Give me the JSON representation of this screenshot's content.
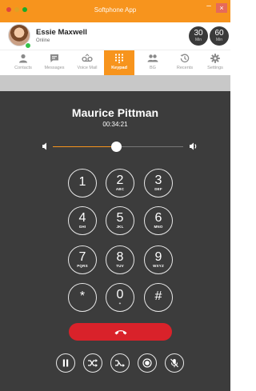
{
  "window": {
    "title": "Softphone App"
  },
  "user": {
    "name": "Essie Maxwell",
    "status": "Online"
  },
  "counters": [
    {
      "value": "30",
      "unit": "Min"
    },
    {
      "value": "60",
      "unit": "Min"
    }
  ],
  "tabs": [
    {
      "label": "Contacts",
      "icon": "person-icon"
    },
    {
      "label": "Messages",
      "icon": "message-icon"
    },
    {
      "label": "Voice Mail",
      "icon": "voicemail-icon"
    },
    {
      "label": "Keypad",
      "icon": "keypad-icon",
      "active": true
    },
    {
      "label": "BG",
      "icon": "group-icon"
    },
    {
      "label": "Recents",
      "icon": "history-icon"
    },
    {
      "label": "Settings",
      "icon": "gear-icon"
    }
  ],
  "call": {
    "name": "Maurice Pittman",
    "duration": "00:34:21",
    "volume": 0.49
  },
  "keys": [
    {
      "digit": "1",
      "letters": ""
    },
    {
      "digit": "2",
      "letters": "ABC"
    },
    {
      "digit": "3",
      "letters": "DEF"
    },
    {
      "digit": "4",
      "letters": "GHI"
    },
    {
      "digit": "5",
      "letters": "JKL"
    },
    {
      "digit": "6",
      "letters": "MNO"
    },
    {
      "digit": "7",
      "letters": "PQRS"
    },
    {
      "digit": "8",
      "letters": "TUV"
    },
    {
      "digit": "9",
      "letters": "WXYZ"
    },
    {
      "digit": "*",
      "letters": ""
    },
    {
      "digit": "0",
      "letters": "+"
    },
    {
      "digit": "#",
      "letters": ""
    }
  ],
  "controls": [
    "pause-icon",
    "shuffle-icon",
    "merge-icon",
    "record-icon",
    "mute-mic-icon"
  ],
  "colors": {
    "accent": "#f7941d",
    "hangup": "#d9222a",
    "panel": "#3c3c3c"
  }
}
